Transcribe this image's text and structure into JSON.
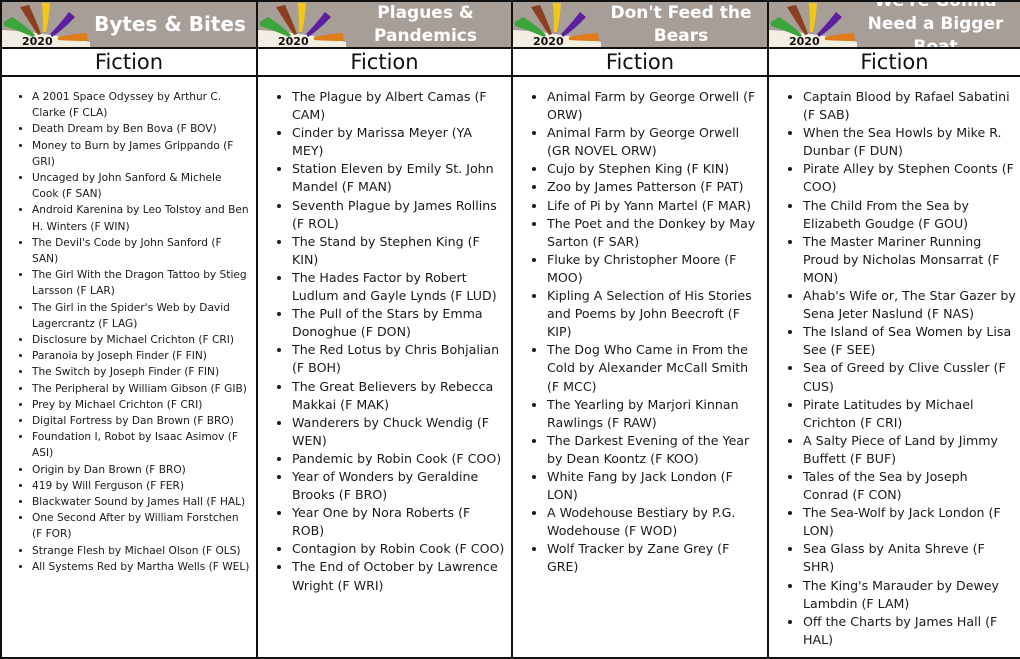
{
  "logo": {
    "year": "2020",
    "ray_colors": [
      "#3aa63a",
      "#8b3f1f",
      "#f5c518",
      "#5b1fa0",
      "#e07b1a"
    ],
    "base_color": "#f3eee2"
  },
  "columns": [
    {
      "title": "Bytes & Bites",
      "subtitle": "Fiction",
      "items": [
        "A 2001 Space Odyssey by Arthur C. Clarke (F CLA)",
        "Death Dream by Ben Bova (F BOV)",
        "Money to Burn by James Grippando (F GRI)",
        "Uncaged by John Sanford & Michele Cook (F SAN)",
        "Android Karenina by Leo Tolstoy and Ben H. Winters (F WIN)",
        "The Devil's Code by John Sanford (F SAN)",
        "The Girl With the Dragon Tattoo by Stieg Larsson (F LAR)",
        "The Girl in the Spider's Web by David Lagercrantz (F LAG)",
        "Disclosure by Michael Crichton (F CRI)",
        "Paranoia by Joseph Finder (F FIN)",
        "The Switch by Joseph Finder (F FIN)",
        "The Peripheral by William Gibson (F GIB)",
        "Prey by Michael Crichton (F CRI)",
        "Digital Fortress by Dan Brown (F BRO)",
        "Foundation I, Robot by Isaac Asimov (F ASI)",
        "Origin by Dan Brown (F BRO)",
        "419 by Will Ferguson (F FER)",
        "Blackwater Sound by James Hall (F HAL)",
        "One Second After by William Forstchen (F FOR)",
        "Strange Flesh by Michael Olson (F OLS)",
        "All Systems Red by Martha Wells (F WEL)"
      ]
    },
    {
      "title": "Plagues & Pandemics",
      "subtitle": "Fiction",
      "items": [
        "The Plague by Albert Camas (F CAM)",
        "Cinder by Marissa Meyer (YA MEY)",
        "Station Eleven by Emily St. John Mandel (F MAN)",
        "Seventh Plague by James Rollins (F ROL)",
        "The Stand by Stephen King (F KIN)",
        "The Hades Factor by Robert Ludlum and Gayle Lynds (F LUD)",
        "The Pull of the Stars by Emma Donoghue (F DON)",
        "The Red Lotus by Chris Bohjalian (F BOH)",
        "The Great Believers by Rebecca Makkai (F MAK)",
        "Wanderers by Chuck Wendig (F WEN)",
        "Pandemic by Robin Cook (F COO)",
        "Year of Wonders by Geraldine Brooks (F BRO)",
        "Year One by Nora Roberts (F ROB)",
        "Contagion by Robin Cook (F COO)",
        "The End of October by Lawrence Wright (F WRI)"
      ]
    },
    {
      "title": "Don't Feed the Bears",
      "subtitle": "Fiction",
      "items": [
        "Animal Farm by George Orwell (F ORW)",
        "Animal Farm by George Orwell (GR NOVEL ORW)",
        "Cujo by Stephen King (F KIN)",
        "Zoo by James Patterson (F PAT)",
        "Life of Pi by Yann Martel (F MAR)",
        "The Poet and the Donkey by May Sarton (F SAR)",
        "Fluke by Christopher Moore (F MOO)",
        "Kipling A Selection of His Stories and Poems by John Beecroft (F KIP)",
        "The Dog Who Came in From the Cold by Alexander McCall Smith (F MCC)",
        "The Yearling by Marjori Kinnan Rawlings (F RAW)",
        "The Darkest Evening of the Year by Dean Koontz (F KOO)",
        "White Fang by Jack London (F LON)",
        "A Wodehouse Bestiary by P.G. Wodehouse (F WOD)",
        "Wolf Tracker by Zane Grey (F GRE)"
      ]
    },
    {
      "title": "We're Gonna Need a Bigger Boat",
      "subtitle": "Fiction",
      "items": [
        "Captain Blood by Rafael Sabatini (F SAB)",
        "When the Sea Howls by Mike R. Dunbar (F DUN)",
        "Pirate Alley by Stephen Coonts (F COO)",
        "The Child From the Sea by Elizabeth Goudge (F GOU)",
        "The Master Mariner Running Proud by Nicholas Monsarrat (F MON)",
        "Ahab's Wife or, The Star Gazer by Sena Jeter Naslund (F NAS)",
        "The Island of Sea Women by Lisa See (F SEE)",
        " Sea of Greed by Clive Cussler (F CUS)",
        "Pirate Latitudes by Michael Crichton (F CRI)",
        " A Salty Piece of Land by Jimmy Buffett (F BUF)",
        " Tales of the Sea by Joseph Conrad (F CON)",
        "The Sea-Wolf by Jack London (F LON)",
        " Sea Glass by Anita Shreve (F SHR)",
        "The King's Marauder by Dewey Lambdin (F LAM)",
        "Off the Charts by James Hall (F HAL)"
      ]
    }
  ]
}
